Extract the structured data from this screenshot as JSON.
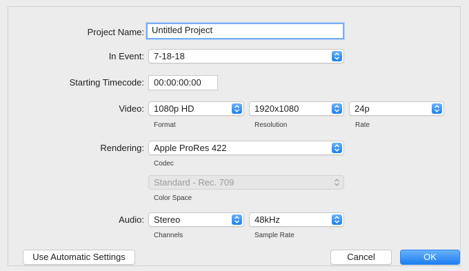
{
  "project_name": {
    "label": "Project Name:",
    "value": "Untitled Project"
  },
  "in_event": {
    "label": "In Event:",
    "value": "7-18-18"
  },
  "starting_timecode": {
    "label": "Starting Timecode:",
    "value": "00:00:00:00"
  },
  "video": {
    "label": "Video:",
    "format": {
      "value": "1080p HD",
      "caption": "Format"
    },
    "resolution": {
      "value": "1920x1080",
      "caption": "Resolution"
    },
    "rate": {
      "value": "24p",
      "caption": "Rate"
    }
  },
  "rendering": {
    "label": "Rendering:",
    "codec": {
      "value": "Apple ProRes 422",
      "caption": "Codec"
    },
    "color_space": {
      "value": "Standard - Rec. 709",
      "caption": "Color Space"
    }
  },
  "audio": {
    "label": "Audio:",
    "channels": {
      "value": "Stereo",
      "caption": "Channels"
    },
    "sample_rate": {
      "value": "48kHz",
      "caption": "Sample Rate"
    }
  },
  "buttons": {
    "automatic": "Use Automatic Settings",
    "cancel": "Cancel",
    "ok": "OK"
  },
  "icons": {
    "popup": "chevron-up-down-icon"
  },
  "colors": {
    "accent": "#1d7ff0",
    "focus_ring": "#7aaef0",
    "background": "#ececec"
  }
}
